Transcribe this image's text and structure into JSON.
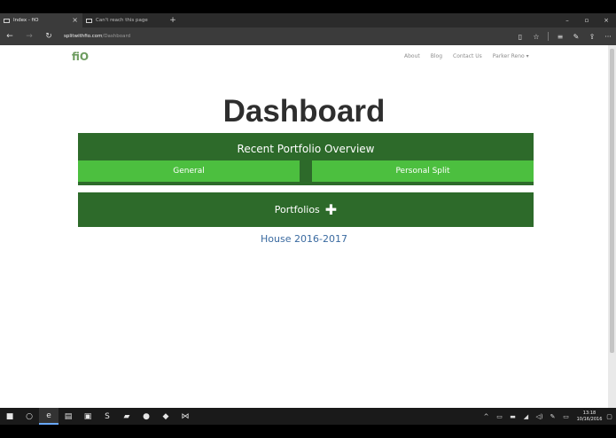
{
  "browser": {
    "tabs": [
      {
        "title": "Index - fiO",
        "close": "×"
      },
      {
        "title": "Can't reach this page",
        "close": ""
      }
    ],
    "new_tab": "+",
    "window_controls": {
      "minimize": "–",
      "maximize": "▫",
      "close": "×"
    },
    "url": {
      "domain": "splitwithfio.com",
      "path": "/Dashboard"
    },
    "nav": {
      "back": "←",
      "forward": "→",
      "refresh": "↻"
    },
    "tools": {
      "reading": "▯",
      "favorite": "☆",
      "hub": "≡",
      "note": "✎",
      "share": "⇪",
      "more": "···"
    }
  },
  "site": {
    "brand": "fiO",
    "nav": [
      "About",
      "Blog",
      "Contact Us"
    ],
    "user_menu": "Parker Reno ▾"
  },
  "dashboard": {
    "title": "Dashboard",
    "overview_title": "Recent Portfolio Overview",
    "general_label": "General",
    "personal_split_label": "Personal Split",
    "portfolios_label": "Portfolios",
    "portfolios_add": "✚",
    "portfolio_items": [
      "House 2016-2017"
    ]
  },
  "taskbar": {
    "start": "■",
    "search": "○",
    "apps": [
      "e",
      "▤",
      "▣",
      "S",
      "▰",
      "●",
      "◆",
      "⋈"
    ],
    "tray": [
      "^",
      "▭",
      "▬",
      "◢",
      "◁)",
      "✎",
      "▭"
    ],
    "time": "13:18",
    "date": "10/16/2016",
    "notifications": "▢"
  }
}
